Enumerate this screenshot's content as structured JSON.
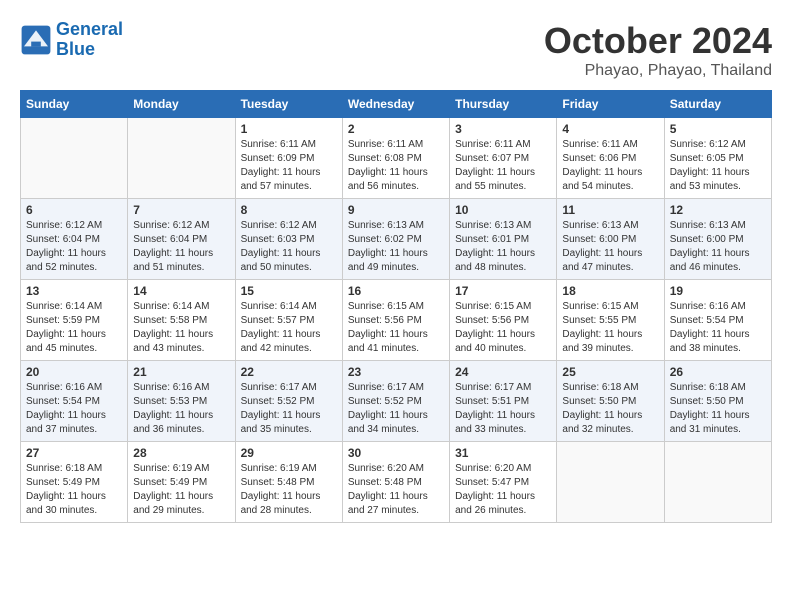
{
  "header": {
    "logo_line1": "General",
    "logo_line2": "Blue",
    "month": "October 2024",
    "location": "Phayao, Phayao, Thailand"
  },
  "days_of_week": [
    "Sunday",
    "Monday",
    "Tuesday",
    "Wednesday",
    "Thursday",
    "Friday",
    "Saturday"
  ],
  "weeks": [
    [
      {
        "day": "",
        "info": ""
      },
      {
        "day": "",
        "info": ""
      },
      {
        "day": "1",
        "info": "Sunrise: 6:11 AM\nSunset: 6:09 PM\nDaylight: 11 hours\nand 57 minutes."
      },
      {
        "day": "2",
        "info": "Sunrise: 6:11 AM\nSunset: 6:08 PM\nDaylight: 11 hours\nand 56 minutes."
      },
      {
        "day": "3",
        "info": "Sunrise: 6:11 AM\nSunset: 6:07 PM\nDaylight: 11 hours\nand 55 minutes."
      },
      {
        "day": "4",
        "info": "Sunrise: 6:11 AM\nSunset: 6:06 PM\nDaylight: 11 hours\nand 54 minutes."
      },
      {
        "day": "5",
        "info": "Sunrise: 6:12 AM\nSunset: 6:05 PM\nDaylight: 11 hours\nand 53 minutes."
      }
    ],
    [
      {
        "day": "6",
        "info": "Sunrise: 6:12 AM\nSunset: 6:04 PM\nDaylight: 11 hours\nand 52 minutes."
      },
      {
        "day": "7",
        "info": "Sunrise: 6:12 AM\nSunset: 6:04 PM\nDaylight: 11 hours\nand 51 minutes."
      },
      {
        "day": "8",
        "info": "Sunrise: 6:12 AM\nSunset: 6:03 PM\nDaylight: 11 hours\nand 50 minutes."
      },
      {
        "day": "9",
        "info": "Sunrise: 6:13 AM\nSunset: 6:02 PM\nDaylight: 11 hours\nand 49 minutes."
      },
      {
        "day": "10",
        "info": "Sunrise: 6:13 AM\nSunset: 6:01 PM\nDaylight: 11 hours\nand 48 minutes."
      },
      {
        "day": "11",
        "info": "Sunrise: 6:13 AM\nSunset: 6:00 PM\nDaylight: 11 hours\nand 47 minutes."
      },
      {
        "day": "12",
        "info": "Sunrise: 6:13 AM\nSunset: 6:00 PM\nDaylight: 11 hours\nand 46 minutes."
      }
    ],
    [
      {
        "day": "13",
        "info": "Sunrise: 6:14 AM\nSunset: 5:59 PM\nDaylight: 11 hours\nand 45 minutes."
      },
      {
        "day": "14",
        "info": "Sunrise: 6:14 AM\nSunset: 5:58 PM\nDaylight: 11 hours\nand 43 minutes."
      },
      {
        "day": "15",
        "info": "Sunrise: 6:14 AM\nSunset: 5:57 PM\nDaylight: 11 hours\nand 42 minutes."
      },
      {
        "day": "16",
        "info": "Sunrise: 6:15 AM\nSunset: 5:56 PM\nDaylight: 11 hours\nand 41 minutes."
      },
      {
        "day": "17",
        "info": "Sunrise: 6:15 AM\nSunset: 5:56 PM\nDaylight: 11 hours\nand 40 minutes."
      },
      {
        "day": "18",
        "info": "Sunrise: 6:15 AM\nSunset: 5:55 PM\nDaylight: 11 hours\nand 39 minutes."
      },
      {
        "day": "19",
        "info": "Sunrise: 6:16 AM\nSunset: 5:54 PM\nDaylight: 11 hours\nand 38 minutes."
      }
    ],
    [
      {
        "day": "20",
        "info": "Sunrise: 6:16 AM\nSunset: 5:54 PM\nDaylight: 11 hours\nand 37 minutes."
      },
      {
        "day": "21",
        "info": "Sunrise: 6:16 AM\nSunset: 5:53 PM\nDaylight: 11 hours\nand 36 minutes."
      },
      {
        "day": "22",
        "info": "Sunrise: 6:17 AM\nSunset: 5:52 PM\nDaylight: 11 hours\nand 35 minutes."
      },
      {
        "day": "23",
        "info": "Sunrise: 6:17 AM\nSunset: 5:52 PM\nDaylight: 11 hours\nand 34 minutes."
      },
      {
        "day": "24",
        "info": "Sunrise: 6:17 AM\nSunset: 5:51 PM\nDaylight: 11 hours\nand 33 minutes."
      },
      {
        "day": "25",
        "info": "Sunrise: 6:18 AM\nSunset: 5:50 PM\nDaylight: 11 hours\nand 32 minutes."
      },
      {
        "day": "26",
        "info": "Sunrise: 6:18 AM\nSunset: 5:50 PM\nDaylight: 11 hours\nand 31 minutes."
      }
    ],
    [
      {
        "day": "27",
        "info": "Sunrise: 6:18 AM\nSunset: 5:49 PM\nDaylight: 11 hours\nand 30 minutes."
      },
      {
        "day": "28",
        "info": "Sunrise: 6:19 AM\nSunset: 5:49 PM\nDaylight: 11 hours\nand 29 minutes."
      },
      {
        "day": "29",
        "info": "Sunrise: 6:19 AM\nSunset: 5:48 PM\nDaylight: 11 hours\nand 28 minutes."
      },
      {
        "day": "30",
        "info": "Sunrise: 6:20 AM\nSunset: 5:48 PM\nDaylight: 11 hours\nand 27 minutes."
      },
      {
        "day": "31",
        "info": "Sunrise: 6:20 AM\nSunset: 5:47 PM\nDaylight: 11 hours\nand 26 minutes."
      },
      {
        "day": "",
        "info": ""
      },
      {
        "day": "",
        "info": ""
      }
    ]
  ]
}
